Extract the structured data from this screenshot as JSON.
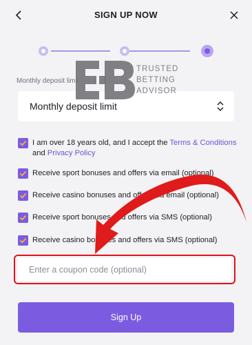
{
  "header": {
    "title": "SIGN UP NOW",
    "back_icon": "chevron-left-icon",
    "close_icon": "close-icon"
  },
  "stepper": {
    "steps": 3,
    "current_step": 3
  },
  "deposit": {
    "field_label": "Monthly deposit limit",
    "selected_value": "Monthly deposit limit"
  },
  "watermark": {
    "line1": "TRUSTED",
    "line2": "BETTING",
    "line3": "ADVISOR"
  },
  "consents": [
    {
      "text_prefix": "I am over 18 years old, and I accept the ",
      "link1": "Terms & Conditions",
      "text_middle": "and ",
      "link2": "Privacy Policy",
      "checked": true
    },
    {
      "text": "Receive sport bonuses and offers via email (optional)",
      "checked": true
    },
    {
      "text": "Receive casino bonuses and offers via email (optional)",
      "checked": true
    },
    {
      "text": "Receive sport bonuses and offers via SMS (optional)",
      "checked": true
    },
    {
      "text": "Receive casino bonuses and offers via SMS (optional)",
      "checked": true
    }
  ],
  "coupon": {
    "placeholder": "Enter a coupon code (optional)",
    "value": ""
  },
  "submit": {
    "label": "Sign Up"
  },
  "colors": {
    "accent": "#7b5ce1",
    "link": "#6e52d4",
    "highlight": "#e3101a",
    "background": "#f3f3f5"
  }
}
